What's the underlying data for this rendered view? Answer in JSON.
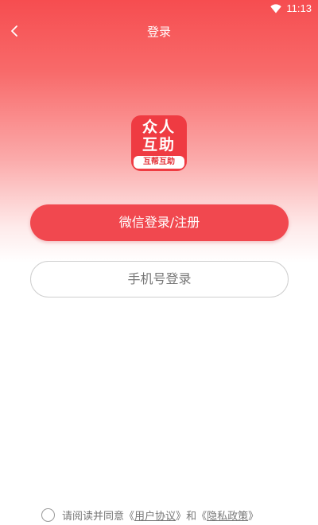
{
  "status_bar": {
    "time": "11:13",
    "wifi_icon": "wifi-icon"
  },
  "header": {
    "title": "登录",
    "back_icon": "chevron-left-icon"
  },
  "logo": {
    "line1": "众人",
    "line2": "互助",
    "tag": "互帮互助",
    "color": "#ef3b42"
  },
  "buttons": {
    "wechat_label": "微信登录/注册",
    "phone_label": "手机号登录"
  },
  "agreement": {
    "prefix": "请阅读并同意",
    "user_agreement": "用户协议",
    "conjunction": "和",
    "privacy_policy": "隐私政策",
    "quote_open": "《",
    "quote_close": "》"
  },
  "colors": {
    "accent": "#f1484f",
    "header_gradient_top": "#f64d50",
    "text_muted": "#777777"
  }
}
